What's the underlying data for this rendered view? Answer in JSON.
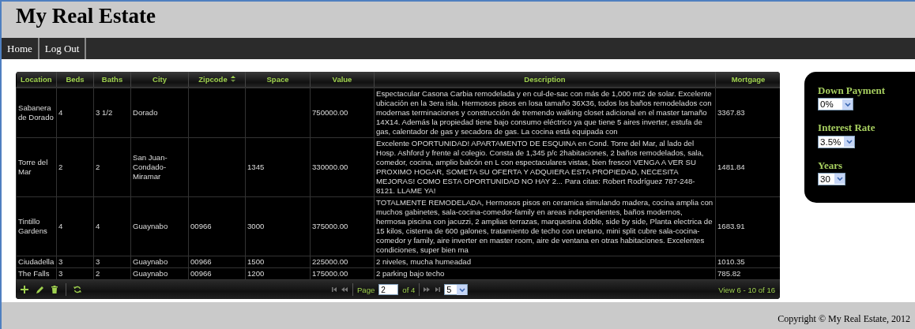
{
  "header": {
    "title": "My Real Estate"
  },
  "nav": {
    "items": [
      {
        "label": "Home"
      },
      {
        "label": "Log Out"
      }
    ]
  },
  "grid": {
    "columns": [
      {
        "label": "Location",
        "sorted": false
      },
      {
        "label": "Beds",
        "sorted": false
      },
      {
        "label": "Baths",
        "sorted": false
      },
      {
        "label": "City",
        "sorted": false
      },
      {
        "label": "Zipcode",
        "sorted": true
      },
      {
        "label": "Space",
        "sorted": false
      },
      {
        "label": "Value",
        "sorted": false
      },
      {
        "label": "Description",
        "sorted": false
      },
      {
        "label": "Mortgage",
        "sorted": false
      }
    ],
    "rows": [
      {
        "cells": [
          "Sabanera de Dorado",
          "4",
          "3 1/2",
          "Dorado",
          "",
          "",
          "750000.00",
          "Espectacular Casona Carbia remodelada y en cul-de-sac con más de 1,000 mt2 de solar. Excelente ubicación en la 3era isla. Hermosos pisos en losa tamaño 36X36, todos los baños remodelados con modernas terminaciones y construcción de tremendo walking closet adicional en el master tamaño 14X14. Además la propiedad tiene bajo consumo eléctrico ya que tiene 5 aires inverter, estufa de gas, calentador de gas y secadora de gas. La cocina está equipada con",
          "3367.83"
        ]
      },
      {
        "cells": [
          "Torre del Mar",
          "2",
          "2",
          "San Juan-Condado-Miramar",
          "",
          "1345",
          "330000.00",
          "Excelente OPORTUNIDAD! APARTAMENTO DE ESQUINA en Cond. Torre del Mar, al lado del Hosp. Ashford y frente al colegio. Consta de 1,345 p/c 2habitaciones, 2 baños remodelados, sala, comedor, cocina, amplio balcón en L con espectaculares vistas, bien fresco! VENGA A VER SU PROXIMO HOGAR, SOMETA SU OFERTA Y ADQUIERA ESTA PROPIEDAD, NECESITA MEJORAS! COMO ESTA OPORTUNIDAD NO HAY 2... Para citas: Robert Rodríguez 787-248-8121. LLAME YA!",
          "1481.84"
        ]
      },
      {
        "cells": [
          "Tintillo Gardens",
          "4",
          "4",
          "Guaynabo",
          "00966",
          "3000",
          "375000.00",
          "TOTALMENTE REMODELADA, Hermosos pisos en ceramica simulando madera, cocina amplia con muchos gabinetes, sala-cocina-comedor-family en areas independientes, baños modernos, hermosa piscina con jacuzzi, 2 amplias terrazas, marquesina doble, side by side, Planta electrica de 15 kilos, cisterna de 600 galones, tratamiento de techo con uretano, mini split cubre sala-cocina-comedor y family, aire inverter en master room, aire de ventana en otras habitaciones. Excelentes condiciones, super bien ma",
          "1683.91"
        ]
      },
      {
        "cells": [
          "Ciudadella",
          "3",
          "3",
          "Guaynabo",
          "00966",
          "1500",
          "225000.00",
          "2 niveles, mucha humeadad",
          "1010.35"
        ]
      },
      {
        "cells": [
          "The Falls",
          "3",
          "2",
          "Guaynabo",
          "00966",
          "1200",
          "175000.00",
          "2 parking bajo techo",
          "785.82"
        ]
      }
    ],
    "pager": {
      "page_label": "Page",
      "page": "2",
      "of_label": "of 4",
      "page_size": "5",
      "view_text": "View 6 - 10 of 16"
    }
  },
  "calculator": {
    "fields": [
      {
        "label": "Down Payment",
        "value": "0%"
      },
      {
        "label": "Interest Rate",
        "value": "3.5%"
      },
      {
        "label": "Years",
        "value": "30"
      }
    ]
  },
  "footer": {
    "text": "Copyright © My Real Estate, 2012"
  }
}
